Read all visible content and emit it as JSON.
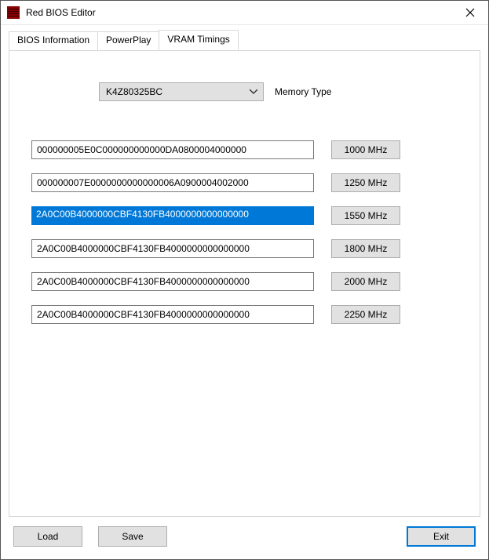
{
  "window": {
    "title": "Red BIOS Editor"
  },
  "tabs": [
    {
      "label": "BIOS Information",
      "active": false
    },
    {
      "label": "PowerPlay",
      "active": false
    },
    {
      "label": "VRAM Timings",
      "active": true
    }
  ],
  "memory_type": {
    "selected": "K4Z80325BC",
    "label": "Memory Type"
  },
  "timings": [
    {
      "value": "000000005E0C000000000000DA0800004000000",
      "freq_label": "1000 MHz",
      "selected": false
    },
    {
      "value": "000000007E0000000000000006A0900004002000",
      "freq_label": "1250 MHz",
      "selected": false
    },
    {
      "value": "2A0C00B4000000CBF4130FB4000000000000000",
      "freq_label": "1550 MHz",
      "selected": true
    },
    {
      "value": "2A0C00B4000000CBF4130FB4000000000000000",
      "freq_label": "1800 MHz",
      "selected": false
    },
    {
      "value": "2A0C00B4000000CBF4130FB4000000000000000",
      "freq_label": "2000 MHz",
      "selected": false
    },
    {
      "value": "2A0C00B4000000CBF4130FB4000000000000000",
      "freq_label": "2250 MHz",
      "selected": false
    }
  ],
  "buttons": {
    "load": "Load",
    "save": "Save",
    "exit": "Exit"
  }
}
